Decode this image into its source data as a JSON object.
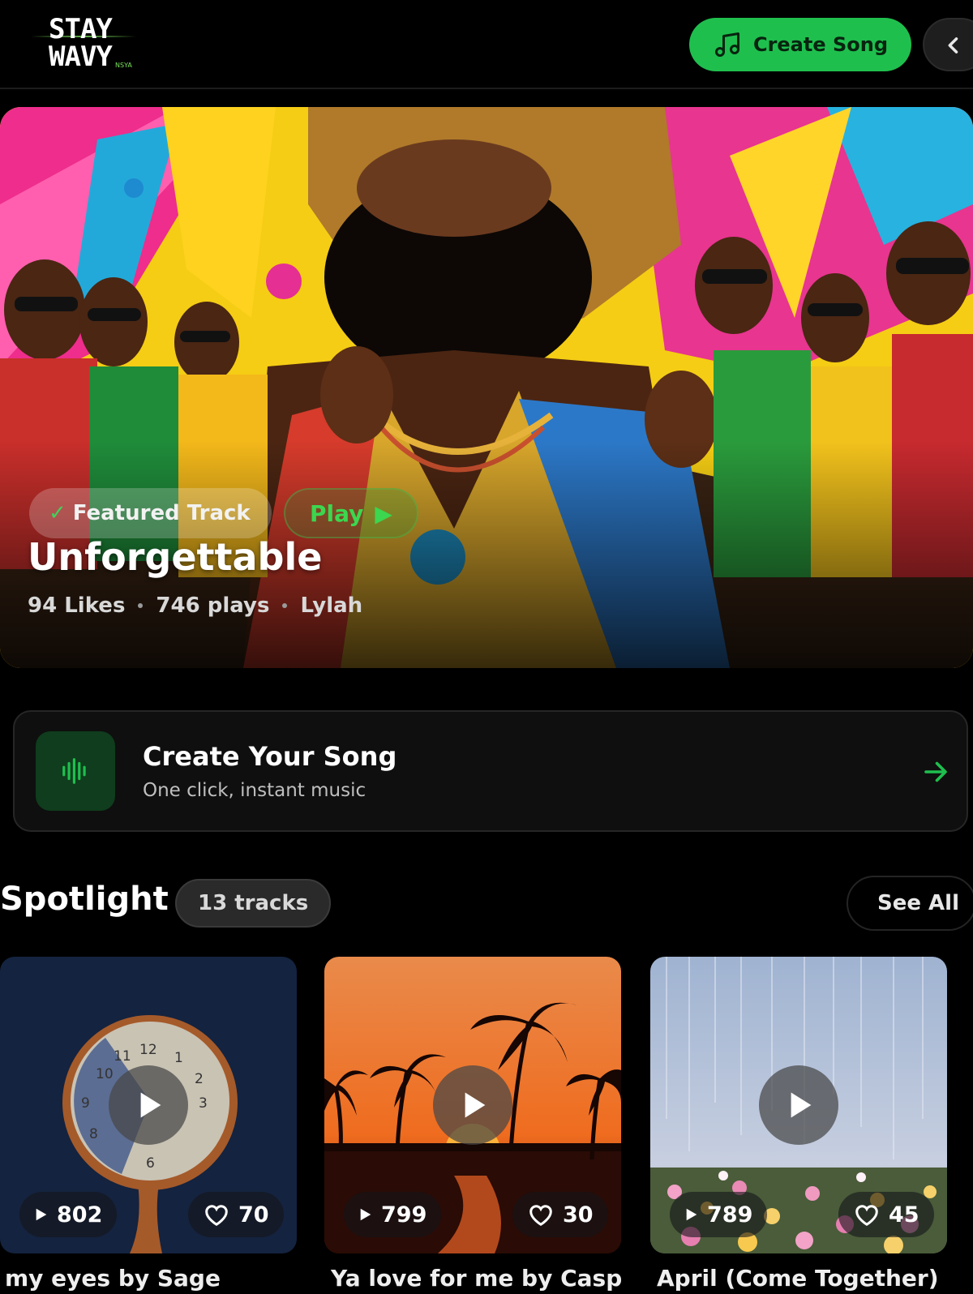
{
  "header": {
    "logo_line1": "STAY",
    "logo_line2": "WAVY",
    "logo_small": "NSYA",
    "create_label": "Create Song",
    "accent": "#1fbf4e"
  },
  "featured": {
    "tag": "Featured Track",
    "play": "Play",
    "title": "Unforgettable",
    "likes": "94 Likes",
    "plays": "746 plays",
    "artist": "Lylah"
  },
  "cta": {
    "title": "Create Your Song",
    "subtitle": "One click, instant music"
  },
  "spotlight": {
    "title": "Spotlight",
    "count": "13 tracks",
    "see_all": "See All",
    "cards": [
      {
        "plays": "802",
        "likes": "70",
        "title": "my eyes by Sage",
        "art": "clock"
      },
      {
        "plays": "799",
        "likes": "30",
        "title": "Ya love for me by Casp",
        "art": "palm-sunset"
      },
      {
        "plays": "789",
        "likes": "45",
        "title": "April (Come Together)",
        "art": "flower-field"
      }
    ]
  },
  "icons": [
    "music-note-icon",
    "chevron-left-icon",
    "check-icon",
    "play-icon",
    "waveform-icon",
    "arrow-right-icon",
    "heart-icon"
  ]
}
